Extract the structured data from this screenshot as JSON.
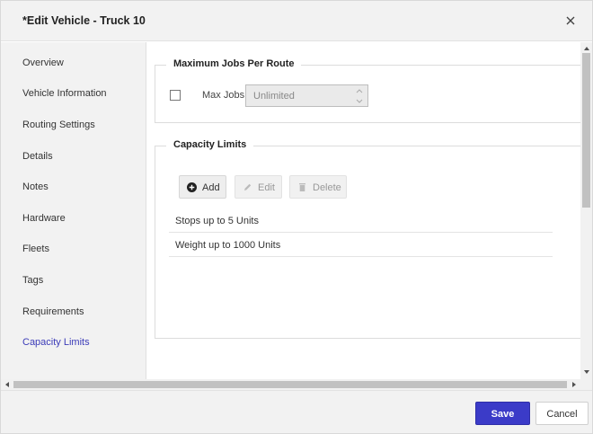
{
  "dialog": {
    "title": "*Edit Vehicle - Truck 10"
  },
  "sidebar": {
    "items": [
      {
        "label": "Overview"
      },
      {
        "label": "Vehicle Information"
      },
      {
        "label": "Routing Settings"
      },
      {
        "label": "Details"
      },
      {
        "label": "Notes"
      },
      {
        "label": "Hardware"
      },
      {
        "label": "Fleets"
      },
      {
        "label": "Tags"
      },
      {
        "label": "Requirements"
      },
      {
        "label": "Capacity Limits"
      }
    ],
    "active_index": 9
  },
  "max_jobs": {
    "legend": "Maximum Jobs Per Route",
    "checked": false,
    "label": "Max Jobs:",
    "value": "Unlimited"
  },
  "capacity": {
    "legend": "Capacity Limits",
    "add_label": "Add",
    "edit_label": "Edit",
    "delete_label": "Delete",
    "rows": [
      "Stops up to 5 Units",
      "Weight up to 1000 Units"
    ]
  },
  "footer": {
    "save_label": "Save",
    "cancel_label": "Cancel"
  },
  "colors": {
    "accent": "#3b3bc8",
    "active_nav": "#3b3bb8"
  }
}
